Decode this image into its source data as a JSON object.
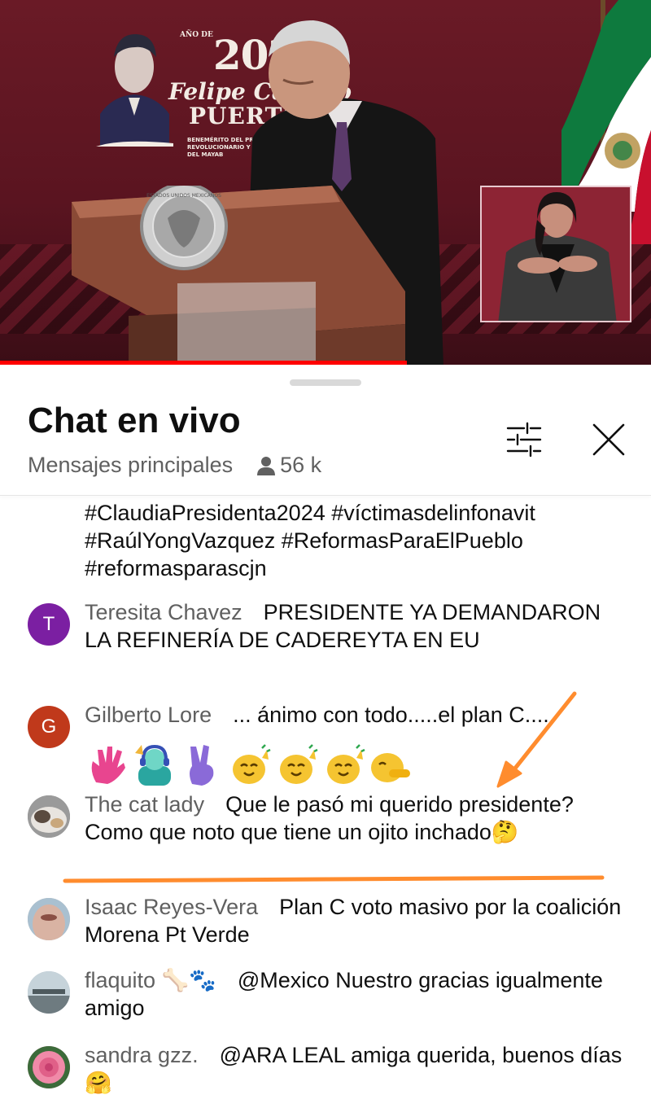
{
  "video": {
    "banner_year": "2024",
    "banner_year_small": "AÑO DE",
    "banner_name": "Felipe Carrillo",
    "banner_surname": "PUERTO",
    "banner_subtitle": "BENEMÉRITO DEL PROLETARIADO, REVOLUCIONARIO Y DEFENSOR DEL MAYAB",
    "seal_text": "ESTADOS UNIDOS MEXICANOS",
    "progress_fraction": 0.625
  },
  "chat": {
    "title": "Chat en vivo",
    "mode": "Mensajes principales",
    "viewers": "56 k",
    "messages": [
      {
        "author": "",
        "text": "#ClaudiaPresidenta2024 #víctimasdelinfonavit #RaúlYongVazquez #ReformasParaElPueblo #reformasparascjn"
      },
      {
        "author": "Teresita Chavez",
        "avatar_letter": "T",
        "avatar_color": "#7b1fa2",
        "text": "PRESIDENTE YA DEMANDARON LA REFINERÍA DE CADEREYTA EN EU"
      },
      {
        "author": "Gilberto Lore",
        "avatar_letter": "G",
        "avatar_color": "#c0391b",
        "text": "... ánimo con todo.....el plan C.....",
        "emojis": [
          "wave-hand",
          "person-headphones",
          "victory-hand",
          "cheer",
          "cheer",
          "cheer",
          "hiding-face"
        ]
      },
      {
        "author": "The cat lady",
        "text": "Que le pasó mi querido presidente? Como que noto que tiene un ojito inchado🤔"
      },
      {
        "author": "Isaac Reyes-Vera",
        "text": "Plan C voto masivo por la coalición Morena Pt Verde"
      },
      {
        "author": "flaquito 🦴🐾",
        "text": "@Mexico Nuestro gracias igualmente amigo"
      },
      {
        "author": "sandra gzz.",
        "text": "@ARA LEAL amiga querida, buenos días 🤗"
      }
    ]
  },
  "colors": {
    "accent_red": "#ff0000",
    "annotation_orange": "#ff8c2e",
    "author_gray": "#606060"
  }
}
